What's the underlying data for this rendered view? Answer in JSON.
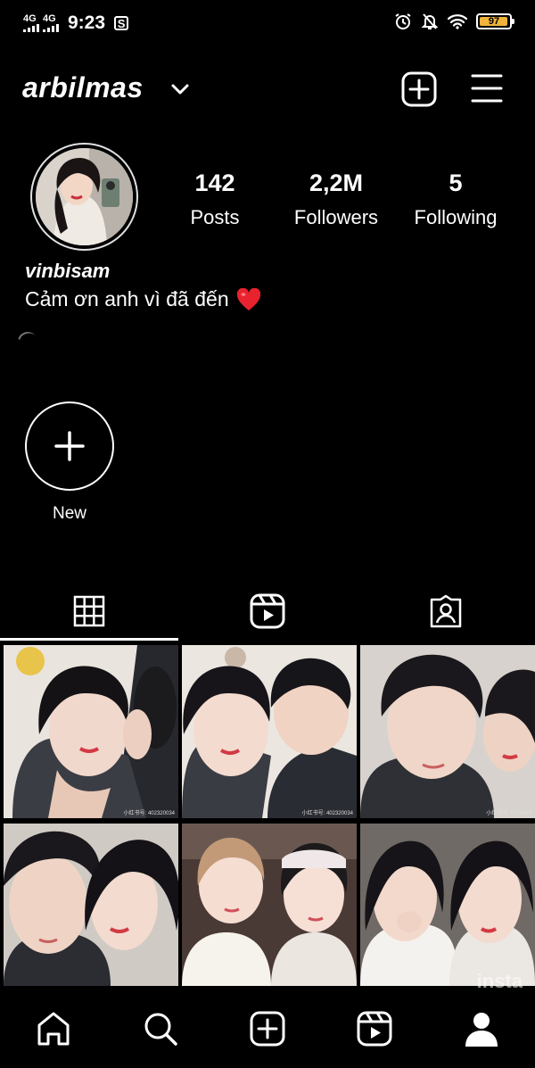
{
  "status_bar": {
    "network_1": "4G",
    "network_2": "4G",
    "time": "9:23",
    "sim_icon_label": "S",
    "battery": "97",
    "battery_level": 0.97,
    "icons": [
      "alarm-icon",
      "silent-bell-icon",
      "wifi-icon",
      "battery-icon"
    ]
  },
  "header": {
    "username": "arbilmas",
    "icons": [
      "chevron-down-icon",
      "add-post-icon",
      "menu-icon"
    ]
  },
  "profile": {
    "display_name": "vinbisam",
    "bio": "Cảm ơn anh vì đã đến",
    "bio_emoji": "heart-icon",
    "stats": [
      {
        "value": "142",
        "label": "Posts"
      },
      {
        "value": "2,2M",
        "label": "Followers"
      },
      {
        "value": "5",
        "label": "Following"
      }
    ]
  },
  "highlights": {
    "new_label": "New"
  },
  "tabs": [
    "grid-icon",
    "reels-icon",
    "tagged-icon"
  ],
  "posts": [
    {
      "watermark": "小红书号: 402320034"
    },
    {
      "watermark": "小红书号: 402320034"
    },
    {
      "watermark": "小红书号: 6171481"
    },
    {
      "watermark": ""
    },
    {
      "watermark": ""
    },
    {
      "watermark": "insta"
    }
  ],
  "bottom_nav": [
    "home-icon",
    "search-icon",
    "create-icon",
    "reels-icon",
    "profile-icon"
  ],
  "colors": {
    "background": "#000000",
    "heart": "#e8222e",
    "battery": "#f0b43c"
  }
}
